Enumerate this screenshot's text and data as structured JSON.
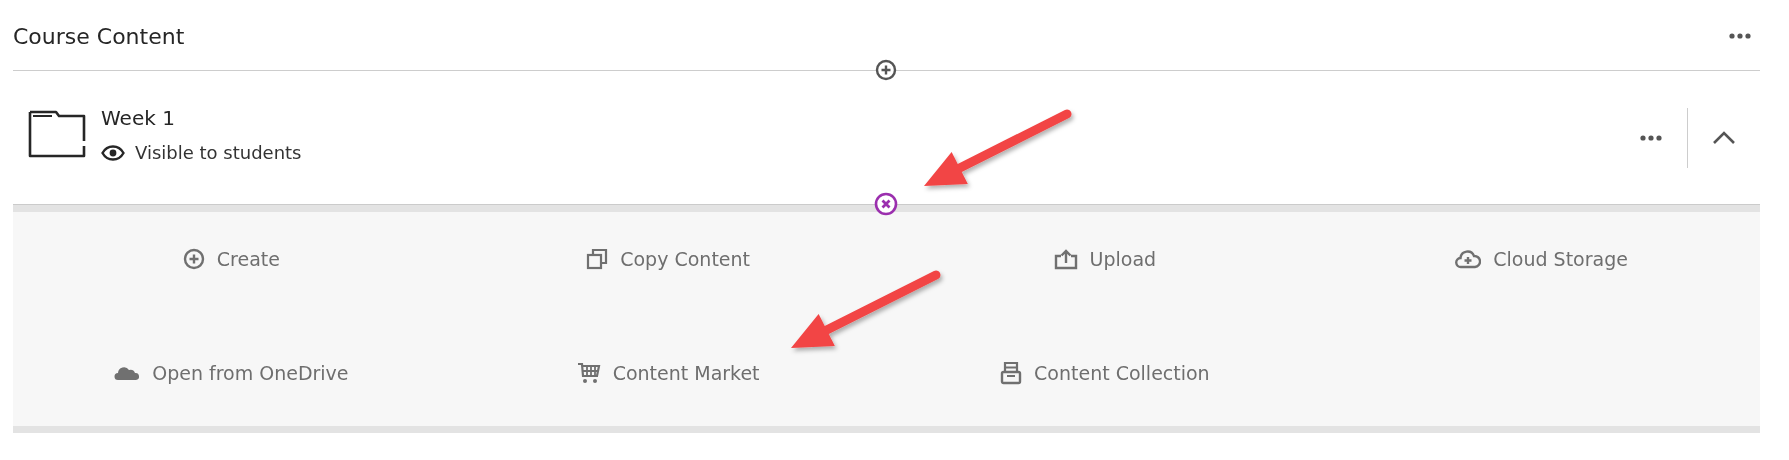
{
  "page": {
    "title": "Course Content"
  },
  "items": [
    {
      "title": "Week 1",
      "visibility": "Visible to students",
      "kind": "folder",
      "expanded": true,
      "options": [
        {
          "label": "Create",
          "kind": "create"
        },
        {
          "label": "Copy Content",
          "kind": "copy"
        },
        {
          "label": "Upload",
          "kind": "upload"
        },
        {
          "label": "Cloud Storage",
          "kind": "cloud-storage"
        },
        {
          "label": "Open from OneDrive",
          "kind": "onedrive"
        },
        {
          "label": "Content Market",
          "kind": "market"
        },
        {
          "label": "Content Collection",
          "kind": "collection"
        }
      ]
    }
  ],
  "annotations": [
    {
      "kind": "arrow"
    },
    {
      "kind": "arrow"
    }
  ]
}
